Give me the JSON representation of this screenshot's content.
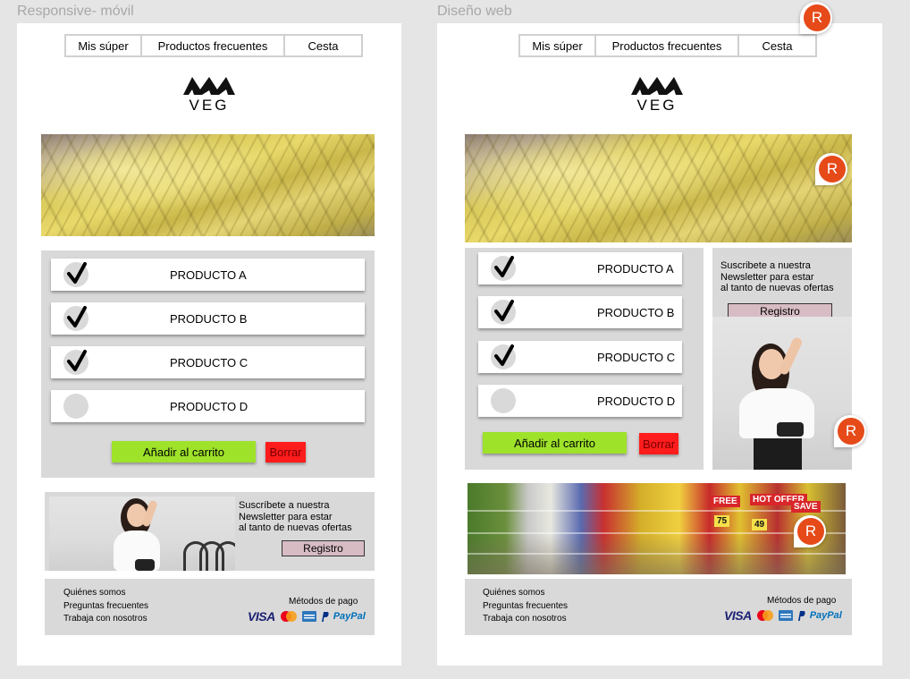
{
  "frames": {
    "mobile_label": "Responsive- móvil",
    "web_label": "Diseño web"
  },
  "nav": {
    "tabs": [
      "Mis súper",
      "Productos frecuentes",
      "Cesta"
    ]
  },
  "logo": {
    "text": "VEG"
  },
  "products": [
    {
      "label": "PRODUCTO A",
      "checked": true
    },
    {
      "label": "PRODUCTO B",
      "checked": true
    },
    {
      "label": "PRODUCTO C",
      "checked": true
    },
    {
      "label": "PRODUCTO D",
      "checked": false
    }
  ],
  "actions": {
    "add_label": "Añadir al carrito",
    "delete_label": "Borrar"
  },
  "newsletter": {
    "text": "Suscríbete a nuestra\nNewsletter para estar\nal tanto de nuevas ofertas",
    "text_web": "Suscribete a nuestra\nNewsletter para estar\nal tanto de nuevas ofertas",
    "register_label": "Registro"
  },
  "footer": {
    "links": [
      "Quiénes somos",
      "Preguntas frecuentes",
      "Trabaja con nosotros"
    ],
    "payment_title": "Métodos de pago",
    "visa": "VISA",
    "paypal": "PayPal"
  },
  "market_signs": [
    "FREE",
    "HOT OFFER",
    "SAVE",
    "75",
    "49"
  ],
  "comment_initial": "R",
  "colors": {
    "accent_green": "#9ee22a",
    "delete_red": "#ff1c1c",
    "register_pink": "#d7bcc4",
    "panel_grey": "#d9d9d9",
    "avatar_orange": "#e64a19"
  }
}
